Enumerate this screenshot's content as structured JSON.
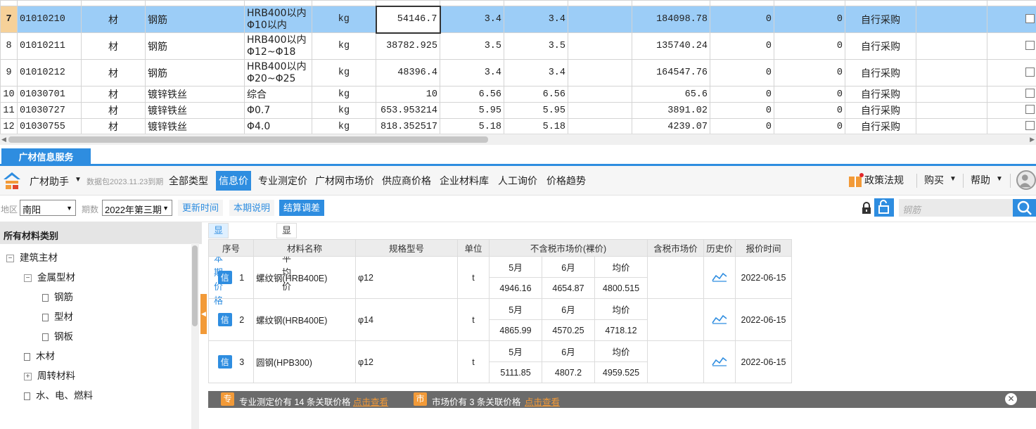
{
  "grid": {
    "rows": [
      {
        "num": "7",
        "code": "01010210",
        "type": "材",
        "name": "钢筋",
        "spec1": "HRB400以内",
        "spec2": "Φ10以内",
        "unit": "kg",
        "qty": "54146.7",
        "p1": "3.4",
        "p2": "3.4",
        "p3": "",
        "amount": "184098.78",
        "a": "0",
        "b": "0",
        "supply": "自行采购",
        "selected": true
      },
      {
        "num": "8",
        "code": "01010211",
        "type": "材",
        "name": "钢筋",
        "spec1": "HRB400以内",
        "spec2": "Φ12~Φ18",
        "unit": "kg",
        "qty": "38782.925",
        "p1": "3.5",
        "p2": "3.5",
        "p3": "",
        "amount": "135740.24",
        "a": "0",
        "b": "0",
        "supply": "自行采购",
        "selected": false
      },
      {
        "num": "9",
        "code": "01010212",
        "type": "材",
        "name": "钢筋",
        "spec1": "HRB400以内",
        "spec2": "Φ20~Φ25",
        "unit": "kg",
        "qty": "48396.4",
        "p1": "3.4",
        "p2": "3.4",
        "p3": "",
        "amount": "164547.76",
        "a": "0",
        "b": "0",
        "supply": "自行采购",
        "selected": false
      },
      {
        "num": "10",
        "code": "01030701",
        "type": "材",
        "name": "镀锌铁丝",
        "spec1": "综合",
        "spec2": "",
        "unit": "kg",
        "qty": "10",
        "p1": "6.56",
        "p2": "6.56",
        "p3": "",
        "amount": "65.6",
        "a": "0",
        "b": "0",
        "supply": "自行采购",
        "selected": false
      },
      {
        "num": "11",
        "code": "01030727",
        "type": "材",
        "name": "镀锌铁丝",
        "spec1": "Φ0.7",
        "spec2": "",
        "unit": "kg",
        "qty": "653.953214",
        "p1": "5.95",
        "p2": "5.95",
        "p3": "",
        "amount": "3891.02",
        "a": "0",
        "b": "0",
        "supply": "自行采购",
        "selected": false
      },
      {
        "num": "12",
        "code": "01030755",
        "type": "材",
        "name": "镀锌铁丝",
        "spec1": "Φ4.0",
        "spec2": "",
        "unit": "kg",
        "qty": "818.352517",
        "p1": "5.18",
        "p2": "5.18",
        "p3": "",
        "amount": "4239.07",
        "a": "0",
        "b": "0",
        "supply": "自行采购",
        "selected": false
      }
    ]
  },
  "panel": {
    "tab_label": "广材信息服务",
    "assistant_label": "广材助手",
    "package_info": "数据包2023.11.23到期",
    "nav_tabs": [
      "全部类型",
      "信息价",
      "专业测定价",
      "广材网市场价",
      "供应商价格",
      "企业材料库",
      "人工询价",
      "价格趋势"
    ],
    "active_tab": 1,
    "policy_label": "政策法规",
    "buy_label": "购买",
    "help_label": "帮助",
    "region_label": "地区",
    "region_value": "南阳",
    "period_label": "期数",
    "period_value": "2022年第三期",
    "update_time_label": "更新时间",
    "period_note_label": "本期说明",
    "settle_label": "结算调差",
    "search_placeholder": "钢筋"
  },
  "tree": {
    "header": "所有材料类别",
    "items": [
      {
        "label": "建筑主材",
        "kind": "collapse"
      },
      {
        "label": "金属型材",
        "kind": "collapse"
      },
      {
        "label": "钢筋",
        "kind": "leaf"
      },
      {
        "label": "型材",
        "kind": "leaf"
      },
      {
        "label": "钢板",
        "kind": "leaf"
      },
      {
        "label": "木材",
        "kind": "leaf"
      },
      {
        "label": "周转材料",
        "kind": "expand"
      },
      {
        "label": "水、电、燃料",
        "kind": "leaf"
      }
    ]
  },
  "subtabs": [
    "显示本期价格",
    "显示平均价"
  ],
  "results": {
    "headers": {
      "seq": "序号",
      "name": "材料名称",
      "spec": "规格型号",
      "unit": "单位",
      "price_ex": "不含税市场价(裸价)",
      "price_in": "含税市场价",
      "history": "历史价",
      "date": "报价时间"
    },
    "badge": "信",
    "month1": "5月",
    "month2": "6月",
    "avg": "均价",
    "rows": [
      {
        "seq": "1",
        "name": "螺纹钢(HRB400E)",
        "spec": "φ12",
        "unit": "t",
        "m5": "4946.16",
        "m6": "4654.87",
        "avg": "4800.515",
        "date": "2022-06-15"
      },
      {
        "seq": "2",
        "name": "螺纹钢(HRB400E)",
        "spec": "φ14",
        "unit": "t",
        "m5": "4865.99",
        "m6": "4570.25",
        "avg": "4718.12",
        "date": "2022-06-15"
      },
      {
        "seq": "3",
        "name": "圆钢(HPB300)",
        "spec": "φ12",
        "unit": "t",
        "m5": "5111.85",
        "m6": "4807.2",
        "avg": "4959.525",
        "date": "2022-06-15"
      }
    ]
  },
  "bottom": {
    "icon1": "专",
    "text1": "专业测定价有 14 条关联价格",
    "link1": "点击查看",
    "icon2": "市",
    "text2": "市场价有 3 条关联价格",
    "link2": "点击查看"
  },
  "colors": {
    "accent": "#2e8de0",
    "selected_row": "#9ccdf7",
    "orange": "#f29a38"
  }
}
